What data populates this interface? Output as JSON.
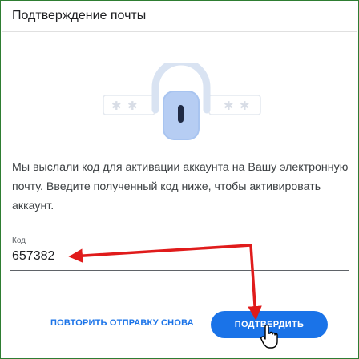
{
  "dialog": {
    "title": "Подтверждение почты",
    "message": "Мы выслали код для активации аккаунта на Вашу электронную почту. Введите полученный код ниже, чтобы активировать аккаунт."
  },
  "code_field": {
    "label": "Код",
    "value": "657382"
  },
  "actions": {
    "resend_label": "ПОВТОРИТЬ ОТПРАВКУ СНОВА",
    "confirm_label": "ПОДТВЕРДИТЬ"
  },
  "colors": {
    "accent": "#1a73e8",
    "annotation": "#e01b1b",
    "frame_border": "#2e7d32",
    "lock_body": "#a8c4f0",
    "lock_shackle": "#d9e3f2"
  },
  "icons": {
    "illustration": "lock-icon",
    "cursor": "hand-pointer-icon"
  }
}
